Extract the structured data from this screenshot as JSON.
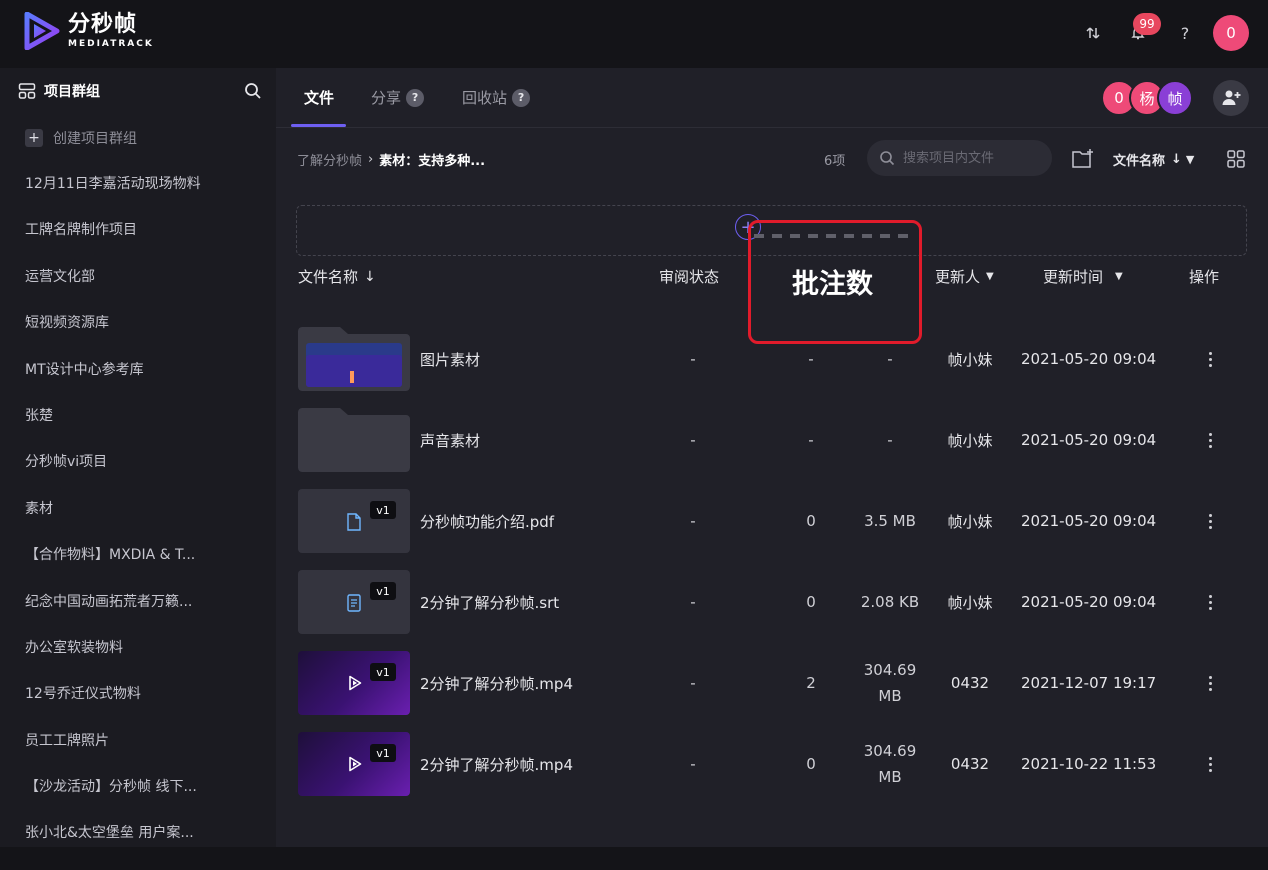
{
  "app": {
    "name_cn": "分秒帧",
    "name_en": "MEDIATRACK",
    "notification_count": "99",
    "help_label": "?",
    "user_avatar": "0"
  },
  "sidebar": {
    "title": "项目群组",
    "create_label": "创建项目群组",
    "items": [
      "12月11日李嘉活动现场物料",
      "工牌名牌制作项目",
      "运营文化部",
      "短视频资源库",
      "MT设计中心参考库",
      "张楚",
      "分秒帧vi项目",
      "素材",
      "【合作物料】MXDIA & T...",
      "纪念中国动画拓荒者万籁...",
      "办公室软装物料",
      "12号乔迁仪式物料",
      "员工工牌照片",
      "【沙龙活动】分秒帧 线下...",
      "张小北&太空堡垒 用户案..."
    ]
  },
  "tabs": [
    {
      "label": "文件",
      "help": ""
    },
    {
      "label": "分享",
      "help": "?"
    },
    {
      "label": "回收站",
      "help": "?"
    }
  ],
  "members": [
    "0",
    "杨",
    "帧"
  ],
  "toolbar": {
    "breadcrumb_parent": "了解分秒帧",
    "breadcrumb_current": "素材：支持多种...",
    "item_count": "6项",
    "search_placeholder": "搜索项目内文件",
    "sort_label": "文件名称"
  },
  "table": {
    "headers": {
      "name": "文件名称",
      "review": "审阅状态",
      "comments": "批注数",
      "updater": "更新人",
      "time": "更新时间",
      "actions": "操作"
    },
    "rows": [
      {
        "type": "folder-image",
        "name": "图片素材",
        "version": "",
        "review": "-",
        "comments": "-",
        "size": "-",
        "updater": "帧小妹",
        "time": "2021-05-20 09:04"
      },
      {
        "type": "folder",
        "name": "声音素材",
        "version": "",
        "review": "-",
        "comments": "-",
        "size": "-",
        "updater": "帧小妹",
        "time": "2021-05-20 09:04"
      },
      {
        "type": "pdf",
        "name": "分秒帧功能介绍.pdf",
        "version": "v1",
        "review": "-",
        "comments": "0",
        "size": "3.5 MB",
        "updater": "帧小妹",
        "time": "2021-05-20 09:04"
      },
      {
        "type": "srt",
        "name": "2分钟了解分秒帧.srt",
        "version": "v1",
        "review": "-",
        "comments": "0",
        "size": "2.08 KB",
        "updater": "帧小妹",
        "time": "2021-05-20 09:04"
      },
      {
        "type": "video",
        "name": "2分钟了解分秒帧.mp4",
        "version": "v1",
        "review": "-",
        "comments": "2",
        "size": "304.69 MB",
        "updater": "0432",
        "time": "2021-12-07 19:17"
      },
      {
        "type": "video",
        "name": "2分钟了解分秒帧.mp4",
        "version": "v1",
        "review": "-",
        "comments": "0",
        "size": "304.69 MB",
        "updater": "0432",
        "time": "2021-10-22 11:53"
      }
    ]
  },
  "colors": {
    "accent": "#6e5ff2",
    "avatar_pink": "#ee4a78",
    "avatar_purple": "#8a3fd6",
    "highlight_red": "#e11b2b",
    "badge_red": "#e8475e"
  }
}
